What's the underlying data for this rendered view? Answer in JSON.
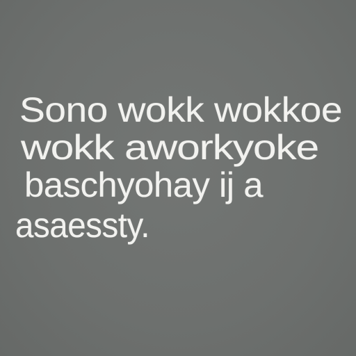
{
  "text": {
    "lines": [
      "Sono wokk wokkoe",
      "wokk aworkyoke",
      "baschyohay ij a",
      "asaessty."
    ]
  },
  "colors": {
    "background": "#6e716f",
    "text": "#f2f2ef"
  }
}
